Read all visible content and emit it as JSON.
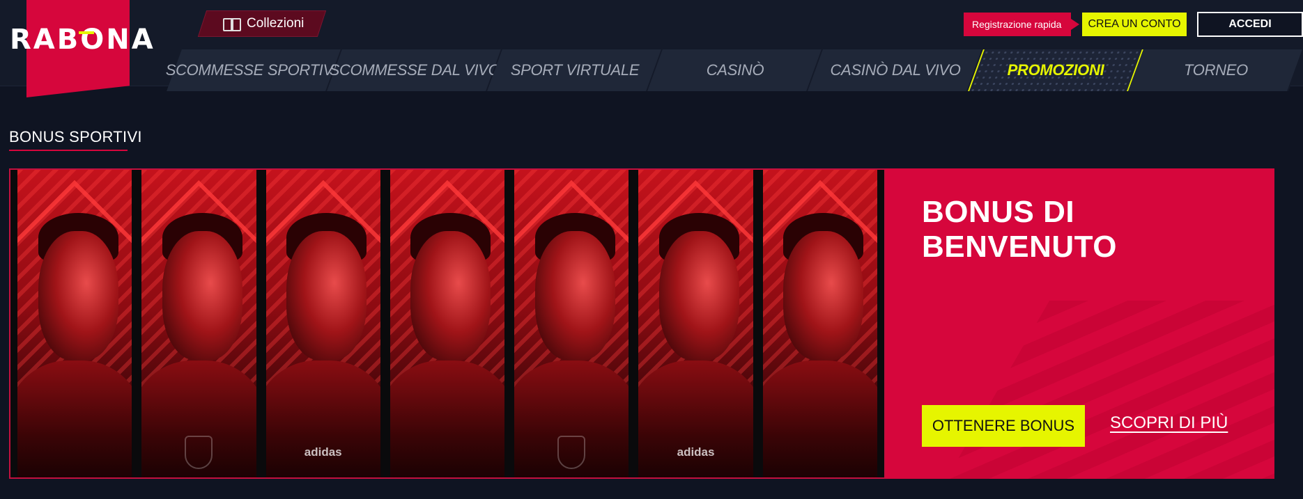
{
  "brand": {
    "logo_text": "RABONA",
    "primary_color": "#d6063c",
    "accent_color": "#e6f500",
    "background_color": "#0f1422"
  },
  "header": {
    "collections_label": "Collezioni",
    "collections_icon": "book-icon",
    "quick_registration_label": "Registrazione rapida",
    "create_account_label": "CREA UN CONTO",
    "login_label": "ACCEDI"
  },
  "nav": {
    "items": [
      {
        "label": "SCOMMESSE SPORTIVE",
        "active": false
      },
      {
        "label": "SCOMMESSE DAL VIVO",
        "active": false
      },
      {
        "label": "SPORT VIRTUALE",
        "active": false
      },
      {
        "label": "CASINÒ",
        "active": false
      },
      {
        "label": "CASINÒ DAL VIVO",
        "active": false
      },
      {
        "label": "PROMOZIONI",
        "active": true
      },
      {
        "label": "TORNEO",
        "active": false
      }
    ]
  },
  "section": {
    "title": "BONUS SPORTIVI"
  },
  "banner": {
    "title": "BONUS DI BENVENUTO",
    "cta_primary": "OTTENERE BONUS",
    "cta_secondary": "SCOPRI DI PIÙ",
    "panel_count": 7,
    "kit_brand": "adidas"
  }
}
